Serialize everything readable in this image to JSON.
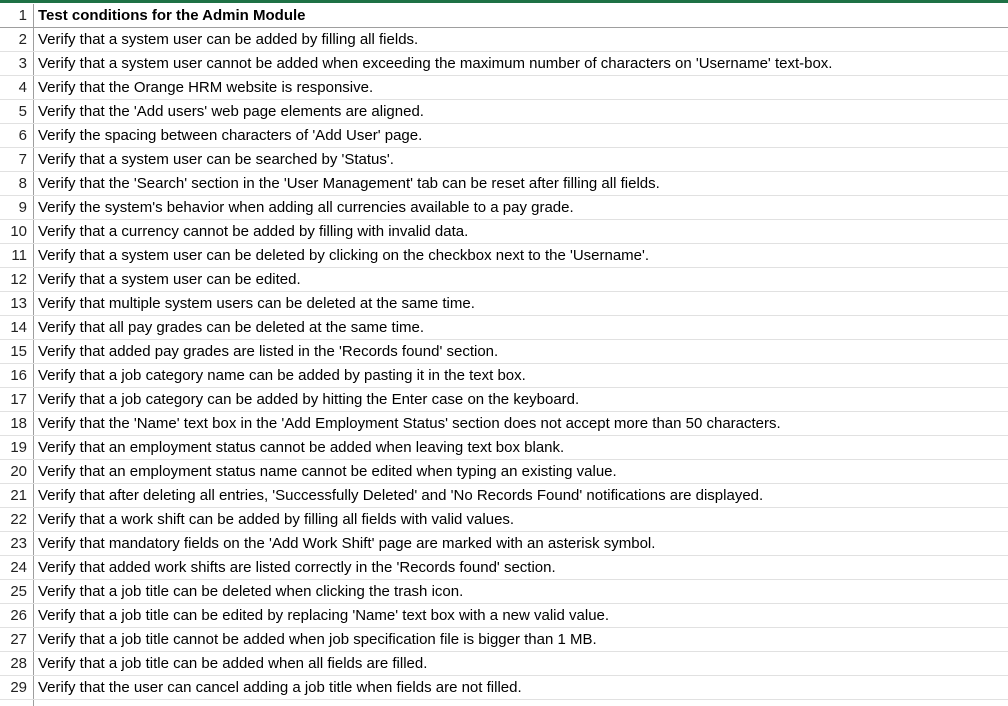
{
  "sheet": {
    "header": "Test conditions for the Admin Module",
    "rows": [
      "Verify that a system user can be added by filling all fields.",
      "Verify that a system user cannot be added when exceeding the maximum number of characters on 'Username' text-box.",
      "Verify that the Orange HRM website is responsive.",
      "Verify that the 'Add users' web page elements are aligned.",
      "Verify the spacing between characters of 'Add User' page.",
      "Verify that a system user can be searched by 'Status'.",
      "Verify that the 'Search' section in the 'User Management' tab can be reset after filling all fields.",
      "Verify the system's behavior when adding all currencies available to a pay grade.",
      "Verify that a currency cannot be added by filling with invalid data.",
      "Verify that a system user can be deleted by clicking on the checkbox next to the 'Username'.",
      "Verify that a system user can be edited.",
      "Verify that multiple system users can be deleted at the same time.",
      "Verify that all pay grades can be deleted at the same time.",
      "Verify that added pay grades are listed in the 'Records found' section.",
      "Verify that a job category name can be added by pasting it in the text box.",
      "Verify that a job category can be added by hitting the Enter case on the keyboard.",
      "Verify that the 'Name' text box in the 'Add Employment Status' section does not accept more than 50 characters.",
      "Verify that an employment status cannot be added when leaving text box blank.",
      "Verify that an employment status name cannot be edited when typing an existing value.",
      "Verify that after deleting all entries, 'Successfully Deleted' and 'No Records Found' notifications are displayed.",
      "Verify that a work shift can be added by filling all fields with valid values.",
      "Verify that mandatory fields on the 'Add Work Shift' page are marked with an asterisk symbol.",
      "Verify that added work shifts are listed correctly in the 'Records found' section.",
      "Verify that a job title can be deleted when clicking the trash icon.",
      "Verify that a job title can be edited by replacing 'Name' text box with a new valid value.",
      "Verify that a job title cannot be added when job specification file is bigger than 1 MB.",
      "Verify that a job title can be added when all fields are filled.",
      "Verify that the user can cancel adding a job title when fields are not filled."
    ]
  },
  "colors": {
    "top_rule": "#1e7145",
    "gridline": "#e1e1e1"
  }
}
